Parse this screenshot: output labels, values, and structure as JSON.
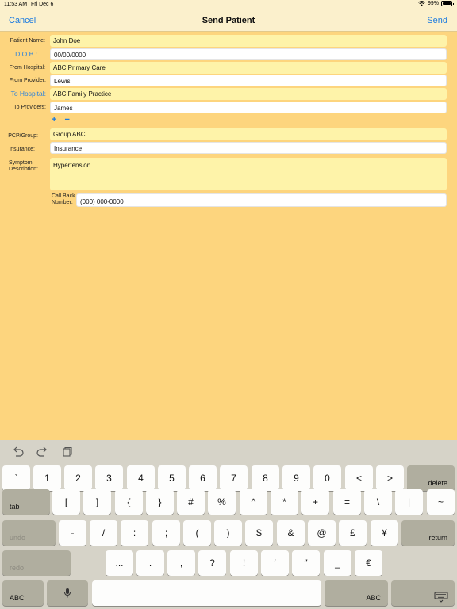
{
  "status": {
    "time": "11:53 AM",
    "date": "Fri Dec 6",
    "battery": "99%"
  },
  "nav": {
    "cancel": "Cancel",
    "title": "Send Patient",
    "send": "Send"
  },
  "form": {
    "patient_name": {
      "label": "Patient Name:",
      "value": "John Doe"
    },
    "dob": {
      "label": "D.O.B.:",
      "value": "00/00/0000"
    },
    "from_hospital": {
      "label": "From Hospital:",
      "value": "ABC Primary Care"
    },
    "from_provider": {
      "label": "From Provider:",
      "value": "Lewis"
    },
    "to_hospital": {
      "label": "To Hospital:",
      "value": "ABC Family Practice"
    },
    "to_providers": {
      "label": "To Providers:",
      "value": "James"
    },
    "plus": "+",
    "minus": "−",
    "pcp_group": {
      "label": "PCP/Group:",
      "value": "Group ABC"
    },
    "insurance": {
      "label": "Insurance:",
      "value": "Insurance"
    },
    "symptom": {
      "label_line1": "Symptom",
      "label_line2": "Description:",
      "value": "Hypertension"
    },
    "callback": {
      "label_line1": "Call Back",
      "label_line2": "Number:",
      "value": "(000) 000-0000"
    }
  },
  "keyboard": {
    "row1": [
      "`",
      "1",
      "2",
      "3",
      "4",
      "5",
      "6",
      "7",
      "8",
      "9",
      "0",
      "<",
      ">"
    ],
    "delete": "delete",
    "tab": "tab",
    "row2": [
      "[",
      "]",
      "{",
      "}",
      "#",
      "%",
      "^",
      "*",
      "+",
      "=",
      "\\",
      "|",
      "~"
    ],
    "undo": "undo",
    "row3": [
      "-",
      "/",
      ":",
      ";",
      "(",
      ")",
      "$",
      "&",
      "@",
      "£",
      "¥"
    ],
    "return": "return",
    "redo": "redo",
    "row4": [
      "...",
      ".",
      ",",
      "?",
      "!",
      "′",
      "″",
      "_",
      "€"
    ],
    "abc_left": "ABC",
    "abc_right": "ABC"
  }
}
